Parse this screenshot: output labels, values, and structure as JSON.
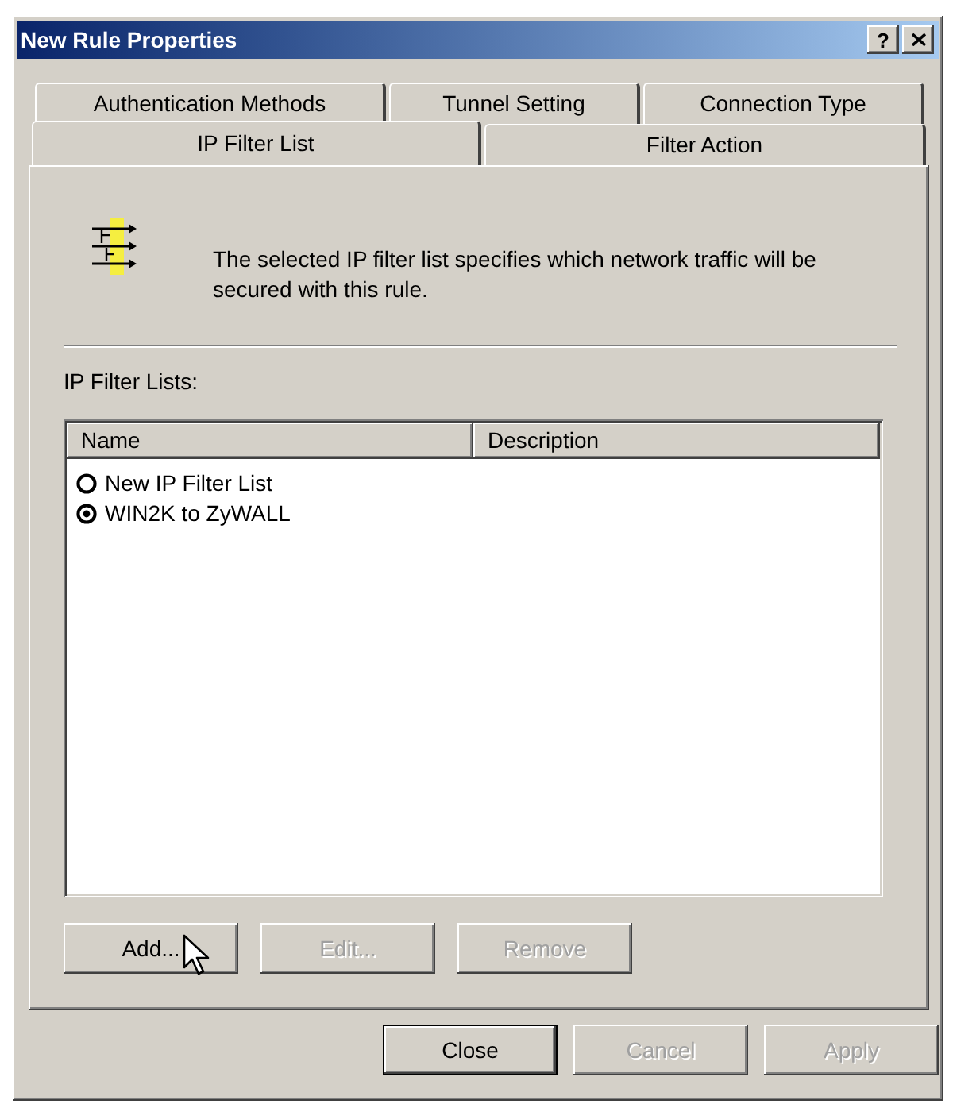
{
  "window": {
    "title": "New Rule Properties",
    "help_button": "?"
  },
  "tab_rows": [
    {
      "tabs": [
        {
          "label": "Authentication Methods",
          "selected": false
        },
        {
          "label": "Tunnel Setting",
          "selected": false
        },
        {
          "label": "Connection Type",
          "selected": false
        }
      ]
    },
    {
      "tabs": [
        {
          "label": "IP Filter List",
          "selected": true
        },
        {
          "label": "Filter Action",
          "selected": false
        }
      ]
    }
  ],
  "description": "The selected IP filter list specifies which network traffic will be secured with this rule.",
  "list_label": "IP Filter Lists:",
  "list": {
    "columns": [
      "Name",
      "Description"
    ],
    "rows": [
      {
        "name": "New IP Filter List",
        "selected": false
      },
      {
        "name": "WIN2K to ZyWALL",
        "selected": true
      }
    ]
  },
  "list_buttons": [
    {
      "label": "Add...",
      "disabled": false
    },
    {
      "label": "Edit...",
      "disabled": true
    },
    {
      "label": "Remove",
      "disabled": true
    }
  ],
  "dialog_buttons": [
    {
      "label": "Close",
      "disabled": false,
      "default": true
    },
    {
      "label": "Cancel",
      "disabled": true,
      "default": false
    },
    {
      "label": "Apply",
      "disabled": true,
      "default": false
    }
  ]
}
